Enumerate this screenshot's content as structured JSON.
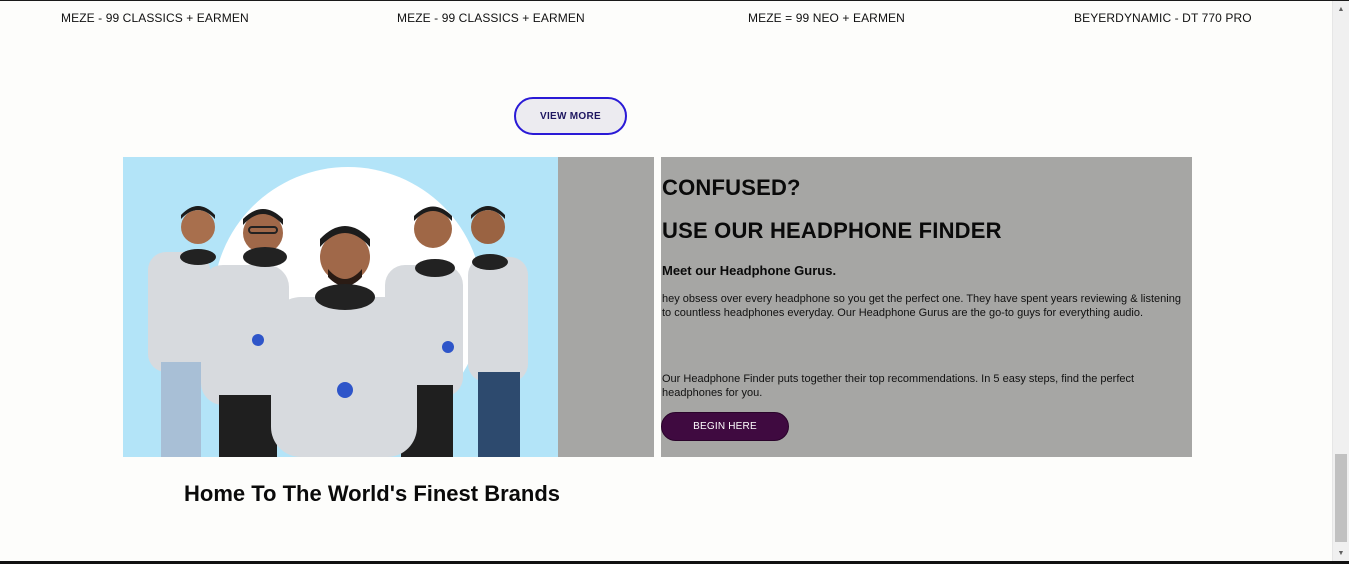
{
  "products": [
    {
      "title": "MEZE - 99 CLASSICS + EARMEN"
    },
    {
      "title": "MEZE - 99 CLASSICS + EARMEN"
    },
    {
      "title": "MEZE = 99 NEO + EARMEN"
    },
    {
      "title": "BEYERDYNAMIC - DT 770 PRO"
    }
  ],
  "view_more_label": "VIEW MORE",
  "finder": {
    "heading_1": "CONFUSED?",
    "heading_2": "USE OUR HEADPHONE FINDER",
    "gurus_title": "Meet our Headphone Gurus.",
    "gurus_text": "hey obsess over every headphone so you get the perfect one. They have spent years reviewing & listening to countless headphones everyday. Our Headphone Gurus are the go-to guys for everything audio.",
    "finder_text": "Our Headphone Finder puts together their top recommendations. In 5 easy steps, find the perfect headphones for you.",
    "button_label": "BEGIN HERE"
  },
  "brands_heading": "Home To The World's Finest Brands",
  "scrollbar": {
    "up_icon": "triangle-up",
    "down_icon": "triangle-down"
  },
  "colors": {
    "view_more_border": "#2a1ad6",
    "begin_button": "#3f0a40",
    "panel_gray": "#a6a6a4",
    "photo_bg": "#b3e4f8"
  }
}
